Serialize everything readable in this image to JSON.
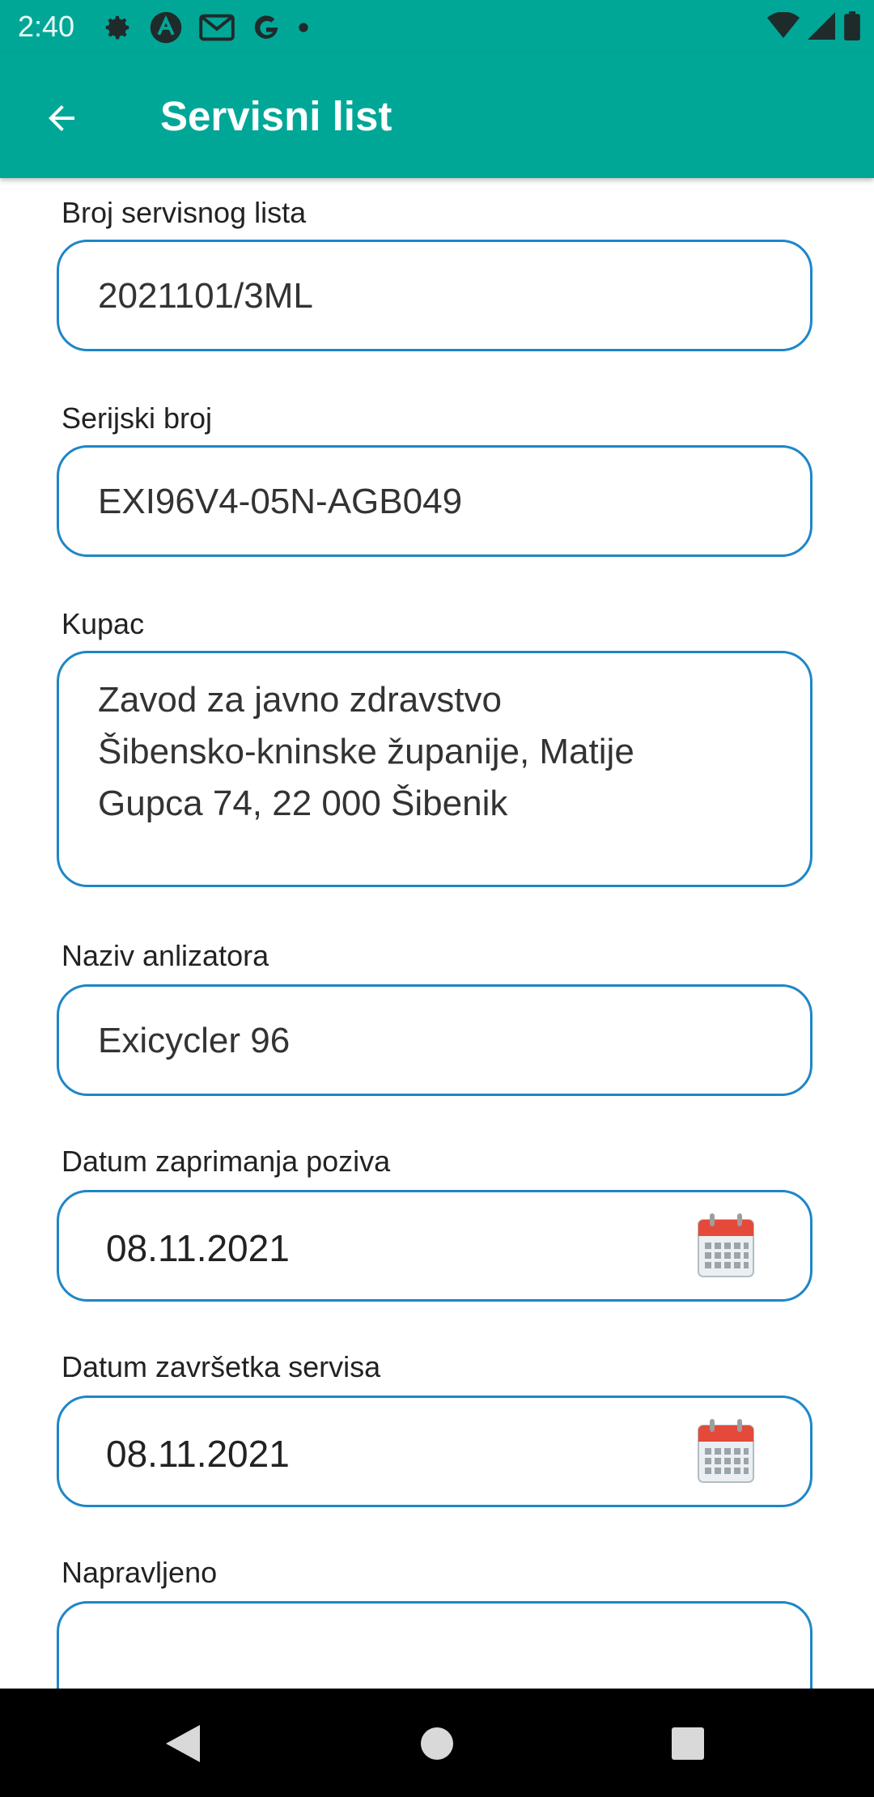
{
  "status_bar": {
    "time": "2:40"
  },
  "app_bar": {
    "title": "Servisni list"
  },
  "form": {
    "broj_label": "Broj servisnog lista",
    "broj_value": "2021101/3ML",
    "serijski_label": "Serijski broj",
    "serijski_value": "EXI96V4-05N-AGB049",
    "kupac_label": "Kupac",
    "kupac_line1": "Zavod za javno zdravstvo",
    "kupac_line2": "Šibensko-kninske županije, Matije",
    "kupac_line3": "Gupca 74, 22 000 Šibenik",
    "naziv_label": "Naziv anlizatora",
    "naziv_value": "Exicycler 96",
    "datum_zaprimanja_label": "Datum zaprimanja poziva",
    "datum_zaprimanja_value": "08.11.2021",
    "datum_zavrsetka_label": "Datum završetka servisa",
    "datum_zavrsetka_value": "08.11.2021",
    "napravljeno_label": "Napravljeno",
    "napravljeno_value": ""
  },
  "colors": {
    "accent": "#00a797",
    "field_border": "#1e86c8",
    "calendar_red": "#e5493a"
  }
}
